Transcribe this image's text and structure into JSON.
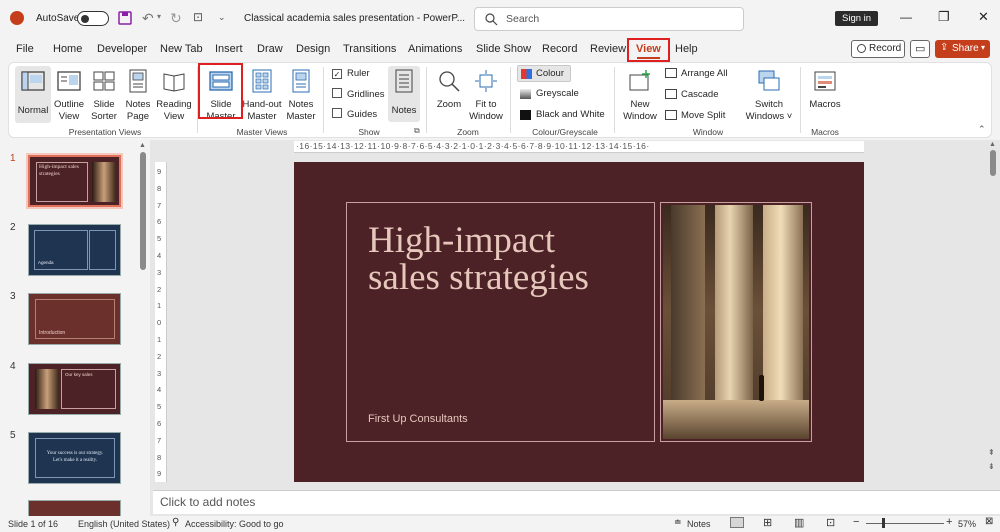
{
  "titlebar": {
    "autosave_label": "AutoSave",
    "doc_title": "Classical academia sales presentation  -  PowerP...",
    "search_placeholder": "Search",
    "signin_label": "Sign in"
  },
  "menu": [
    "File",
    "Home",
    "Developer",
    "New Tab",
    "Insert",
    "Draw",
    "Design",
    "Transitions",
    "Animations",
    "Slide Show",
    "Record",
    "Review",
    "View",
    "Help"
  ],
  "menu_active": "View",
  "menu_right": {
    "record_label": "Record",
    "share_label": "Share"
  },
  "ribbon": {
    "presentation_views": {
      "label": "Presentation Views",
      "normal": "Normal",
      "outline_view": [
        "Outline",
        "View"
      ],
      "slide_sorter": [
        "Slide",
        "Sorter"
      ],
      "notes_page": [
        "Notes",
        "Page"
      ],
      "reading_view": [
        "Reading",
        "View"
      ]
    },
    "master_views": {
      "label": "Master Views",
      "slide_master": [
        "Slide",
        "Master"
      ],
      "handout_master": [
        "Hand-out",
        "Master"
      ],
      "notes_master": [
        "Notes",
        "Master"
      ]
    },
    "show": {
      "label": "Show",
      "ruler": "Ruler",
      "gridlines": "Gridlines",
      "guides": "Guides",
      "notes": "Notes"
    },
    "zoom": {
      "label": "Zoom",
      "zoom": "Zoom",
      "fit_to_window": [
        "Fit to",
        "Window"
      ]
    },
    "colour": {
      "label": "Colour/Greyscale",
      "colour": "Colour",
      "greyscale": "Greyscale",
      "black_and_white": "Black and White"
    },
    "window": {
      "label": "Window",
      "new_window": [
        "New",
        "Window"
      ],
      "arrange_all": "Arrange All",
      "cascade": "Cascade",
      "move_split": "Move Split",
      "switch_windows": [
        "Switch",
        "Windows ˅"
      ]
    },
    "macros": {
      "label": "Macros",
      "macros": "Macros"
    }
  },
  "ruler_h": "·16·15·14·13·12·11·10·9·8·7·6·5·4·3·2·1·0·1·2·3·4·5·6·7·8·9·10·11·12·13·14·15·16·",
  "ruler_v": [
    "9",
    "8",
    "7",
    "6",
    "5",
    "4",
    "3",
    "2",
    "1",
    "0",
    "1",
    "2",
    "3",
    "4",
    "5",
    "6",
    "7",
    "8",
    "9"
  ],
  "thumbnails": [
    {
      "num": "1",
      "text": "High-impact sales strategies"
    },
    {
      "num": "2",
      "text": "Agenda"
    },
    {
      "num": "3",
      "text": "Introduction"
    },
    {
      "num": "4",
      "text": "Our key sales"
    },
    {
      "num": "5",
      "text": "Your success is our strategy. Let's make it a reality."
    }
  ],
  "slide": {
    "title_line1": "High-impact",
    "title_line2": "sales strategies",
    "subtitle": "First Up Consultants"
  },
  "notes_placeholder": "Click to add notes",
  "status": {
    "slide_count": "Slide 1 of 16",
    "language": "English (United States)",
    "accessibility": "Accessibility: Good to go",
    "notes": "Notes",
    "zoom": "57%"
  },
  "colors": {
    "accent": "#c43e1c",
    "slide_bg": "#4c2226",
    "highlight": "#e02020"
  }
}
